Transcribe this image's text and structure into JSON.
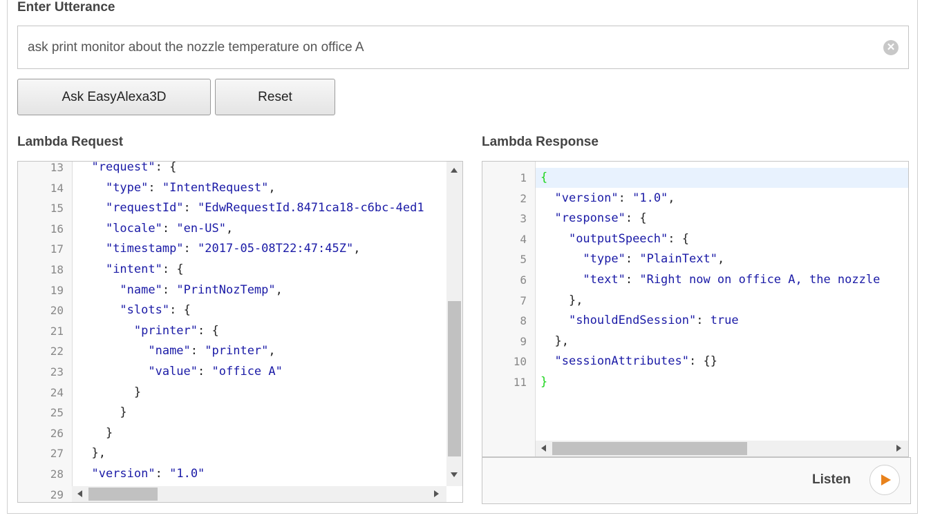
{
  "utterance": {
    "heading": "Enter Utterance",
    "value": "ask print monitor about the nozzle temperature on office A",
    "clear_icon": "clear-circle-icon"
  },
  "buttons": {
    "ask_label": "Ask EasyAlexa3D",
    "reset_label": "Reset"
  },
  "request": {
    "heading": "Lambda Request",
    "lines": [
      {
        "n": "13",
        "text": "  \"request\": {"
      },
      {
        "n": "14",
        "text": "    \"type\": \"IntentRequest\","
      },
      {
        "n": "15",
        "text": "    \"requestId\": \"EdwRequestId.8471ca18-c6bc-4ed1"
      },
      {
        "n": "16",
        "text": "    \"locale\": \"en-US\","
      },
      {
        "n": "17",
        "text": "    \"timestamp\": \"2017-05-08T22:47:45Z\","
      },
      {
        "n": "18",
        "text": "    \"intent\": {"
      },
      {
        "n": "19",
        "text": "      \"name\": \"PrintNozTemp\","
      },
      {
        "n": "20",
        "text": "      \"slots\": {"
      },
      {
        "n": "21",
        "text": "        \"printer\": {"
      },
      {
        "n": "22",
        "text": "          \"name\": \"printer\","
      },
      {
        "n": "23",
        "text": "          \"value\": \"office A\""
      },
      {
        "n": "24",
        "text": "        }"
      },
      {
        "n": "25",
        "text": "      }"
      },
      {
        "n": "26",
        "text": "    }"
      },
      {
        "n": "27",
        "text": "  },"
      },
      {
        "n": "28",
        "text": "  \"version\": \"1.0\""
      },
      {
        "n": "29",
        "text": ""
      }
    ]
  },
  "response": {
    "heading": "Lambda Response",
    "lines": [
      {
        "n": "1",
        "text": "{"
      },
      {
        "n": "2",
        "text": "  \"version\": \"1.0\","
      },
      {
        "n": "3",
        "text": "  \"response\": {"
      },
      {
        "n": "4",
        "text": "    \"outputSpeech\": {"
      },
      {
        "n": "5",
        "text": "      \"type\": \"PlainText\","
      },
      {
        "n": "6",
        "text": "      \"text\": \"Right now on office A, the nozzle"
      },
      {
        "n": "7",
        "text": "    },"
      },
      {
        "n": "8",
        "text": "    \"shouldEndSession\": true"
      },
      {
        "n": "9",
        "text": "  },"
      },
      {
        "n": "10",
        "text": "  \"sessionAttributes\": {}"
      },
      {
        "n": "11",
        "text": "}"
      }
    ]
  },
  "listen": {
    "label": "Listen",
    "icon": "play-icon",
    "icon_color": "#e8821c"
  }
}
